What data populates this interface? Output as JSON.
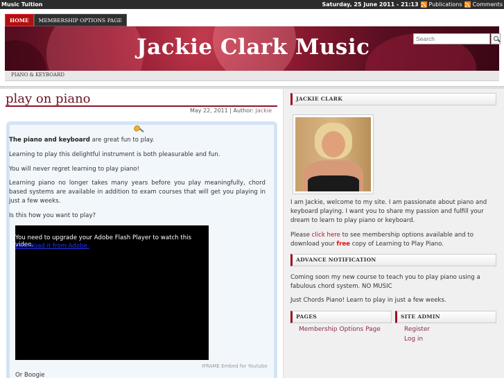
{
  "topbar": {
    "site_name": "Music Tuition",
    "date": "Saturday, 25 June 2011 - 21:13",
    "publications": "Publications",
    "comments": "Comments"
  },
  "nav": {
    "home": "HOME",
    "membership": "MEMBERSHIP OPTIONS PAGE"
  },
  "header": {
    "title": "Jackie Clark Music",
    "search_placeholder": "Search"
  },
  "subnav": {
    "item": "PIANO & KEYBOARD"
  },
  "post": {
    "title": "play on piano",
    "date": "May 22, 2011",
    "author_label": "| Author:",
    "author": "Jackie",
    "intro_bold": "The piano and keyboard",
    "intro_rest": " are great fun to play.",
    "p2": "Learning to play this delightful instrument is both pleasurable and fun.",
    "p3": "You will never regret learning to play piano!",
    "p4": "Learning piano no longer takes many years before you play meaningfully, chord based systems are available in addition to exam courses that will get you playing in just a few weeks.",
    "p5": "Is this how you want to play?",
    "video_msg": "You need to upgrade your Adobe Flash Player to watch this video.",
    "video_link": "Download it from Adobe.",
    "iframe_note": "IFRAME Embed for Youtube",
    "p6": "Or Boogie"
  },
  "sidebar": {
    "jackie_heading": "JACKIE CLARK",
    "about": "I am Jackie, welcome to my site. I am passionate about piano and keyboard playing. I want you to share my passion and fulfill your dream to learn to play piano or keyboard.",
    "please": "Please ",
    "click_here": "click here",
    "please_rest": " to see membership options available and to download your ",
    "free": "free",
    "copy": " copy of Learning to Play Piano.",
    "advance_heading": "ADVANCE NOTIFICATION",
    "advance_p1": "Coming soon my new course to teach you to play piano using a fabulous chord system. NO MUSIC",
    "advance_p2": "Just Chords Piano! Learn to play in just a few weeks.",
    "pages_heading": "PAGES",
    "pages_link": "Membership Options Page",
    "admin_heading": "SITE ADMIN",
    "register": "Register",
    "login": "Log in"
  }
}
